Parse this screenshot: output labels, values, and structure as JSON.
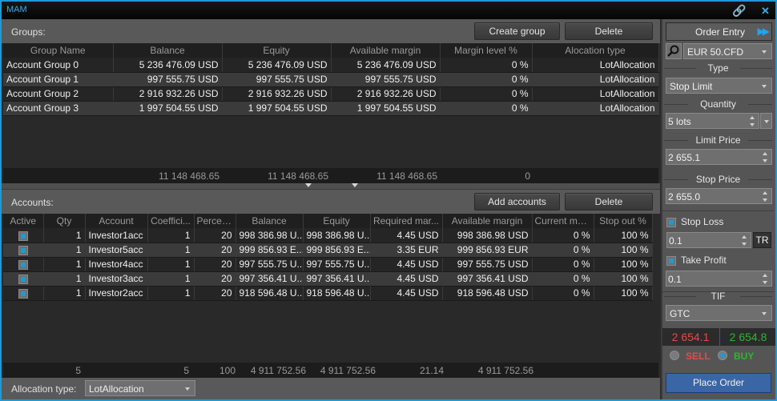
{
  "window": {
    "title": "MAM",
    "link_icon": "link-icon",
    "close_icon": "close-icon"
  },
  "groups": {
    "label": "Groups:",
    "create_button": "Create group",
    "delete_button": "Delete",
    "columns": [
      "Group Name",
      "Balance",
      "Equity",
      "Available margin",
      "Margin level %",
      "Alocation type"
    ],
    "rows": [
      [
        "Account Group 0",
        "5 236 476.09 USD",
        "5 236 476.09 USD",
        "5 236 476.09 USD",
        "0 %",
        "LotAllocation"
      ],
      [
        "Account Group 1",
        "997 555.75 USD",
        "997 555.75 USD",
        "997 555.75 USD",
        "0 %",
        "LotAllocation"
      ],
      [
        "Account Group 2",
        "2 916 932.26 USD",
        "2 916 932.26 USD",
        "2 916 932.26 USD",
        "0 %",
        "LotAllocation"
      ],
      [
        "Account Group 3",
        "1 997 504.55 USD",
        "1 997 504.55 USD",
        "1 997 504.55 USD",
        "0 %",
        "LotAllocation"
      ]
    ],
    "totals": {
      "balance": "11 148 468.65",
      "equity": "11 148 468.65",
      "available_margin": "11 148 468.65",
      "margin_level": "0"
    }
  },
  "accounts": {
    "label": "Accounts:",
    "add_button": "Add accounts",
    "delete_button": "Delete",
    "columns": [
      "Active",
      "Qty",
      "Account",
      "Coeffici...",
      "Percent...",
      "Balance",
      "Equity",
      "Required mar...",
      "Available margin",
      "Current ma...",
      "Stop out %"
    ],
    "rows": [
      {
        "active": true,
        "qty": "1",
        "account": "Investor1acc",
        "coefficient": "1",
        "percent": "20",
        "balance": "998 386.98 U...",
        "equity": "998 386.98 U...",
        "required_margin": "4.45 USD",
        "available_margin": "998 386.98 USD",
        "current_margin": "0 %",
        "stop_out": "100 %"
      },
      {
        "active": true,
        "qty": "1",
        "account": "Investor5acc",
        "coefficient": "1",
        "percent": "20",
        "balance": "999 856.93 E...",
        "equity": "999 856.93 E...",
        "required_margin": "3.35 EUR",
        "available_margin": "999 856.93 EUR",
        "current_margin": "0 %",
        "stop_out": "100 %"
      },
      {
        "active": true,
        "qty": "1",
        "account": "Investor4acc",
        "coefficient": "1",
        "percent": "20",
        "balance": "997 555.75 U...",
        "equity": "997 555.75 U...",
        "required_margin": "4.45 USD",
        "available_margin": "997 555.75 USD",
        "current_margin": "0 %",
        "stop_out": "100 %"
      },
      {
        "active": true,
        "qty": "1",
        "account": "Investor3acc",
        "coefficient": "1",
        "percent": "20",
        "balance": "997 356.41 U...",
        "equity": "997 356.41 U...",
        "required_margin": "4.45 USD",
        "available_margin": "997 356.41 USD",
        "current_margin": "0 %",
        "stop_out": "100 %"
      },
      {
        "active": true,
        "qty": "1",
        "account": "Investor2acc",
        "coefficient": "1",
        "percent": "20",
        "balance": "918 596.48 U...",
        "equity": "918 596.48 U...",
        "required_margin": "4.45 USD",
        "available_margin": "918 596.48 USD",
        "current_margin": "0 %",
        "stop_out": "100 %"
      }
    ],
    "totals": {
      "qty": "5",
      "coefficient": "5",
      "percent": "100",
      "balance": "4 911 752.56",
      "equity": "4 911 752.56",
      "required_margin": "21.14",
      "available_margin": "4 911 752.56"
    },
    "allocation_label": "Allocation type:",
    "allocation_value": "LotAllocation"
  },
  "order_entry": {
    "title": "Order Entry",
    "symbol": "EUR 50.CFD",
    "type_label": "Type",
    "type_value": "Stop Limit",
    "quantity_label": "Quantity",
    "quantity_value": "5 lots",
    "limit_price_label": "Limit Price",
    "limit_price_value": "2 655.1",
    "stop_price_label": "Stop Price",
    "stop_price_value": "2 655.0",
    "stop_loss_label": "Stop Loss",
    "stop_loss_checked": true,
    "stop_loss_value": "0.1",
    "tr_button": "TR",
    "take_profit_label": "Take Profit",
    "take_profit_checked": true,
    "take_profit_value": "0.1",
    "tif_label": "TIF",
    "tif_value": "GTC",
    "sell_price": "2 654.1",
    "buy_price": "2 654.8",
    "sell_label": "SELL",
    "buy_label": "BUY",
    "side_selected": "BUY",
    "place_button": "Place Order",
    "colors": {
      "sell": "#e94848",
      "buy": "#2fb52f",
      "accent": "#1e9ad6",
      "place": "#3a66a6"
    }
  }
}
